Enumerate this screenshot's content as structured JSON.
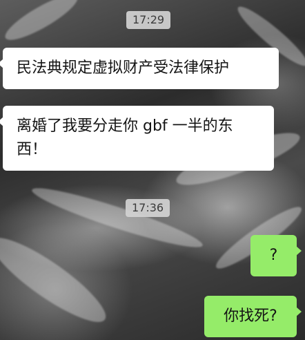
{
  "chat": {
    "timestamps": [
      "17:29",
      "17:36"
    ],
    "messages": [
      {
        "side": "incoming",
        "text": "民法典规定虚拟财产受法律保护"
      },
      {
        "side": "incoming",
        "text": "离婚了我要分走你 gbf 一半的东西！"
      },
      {
        "side": "outgoing",
        "text": "?"
      },
      {
        "side": "outgoing",
        "text": "你找死?"
      }
    ]
  },
  "colors": {
    "incoming_bubble": "#ffffff",
    "outgoing_bubble": "#95ec69",
    "timestamp_chip": "#d2d2d2"
  }
}
